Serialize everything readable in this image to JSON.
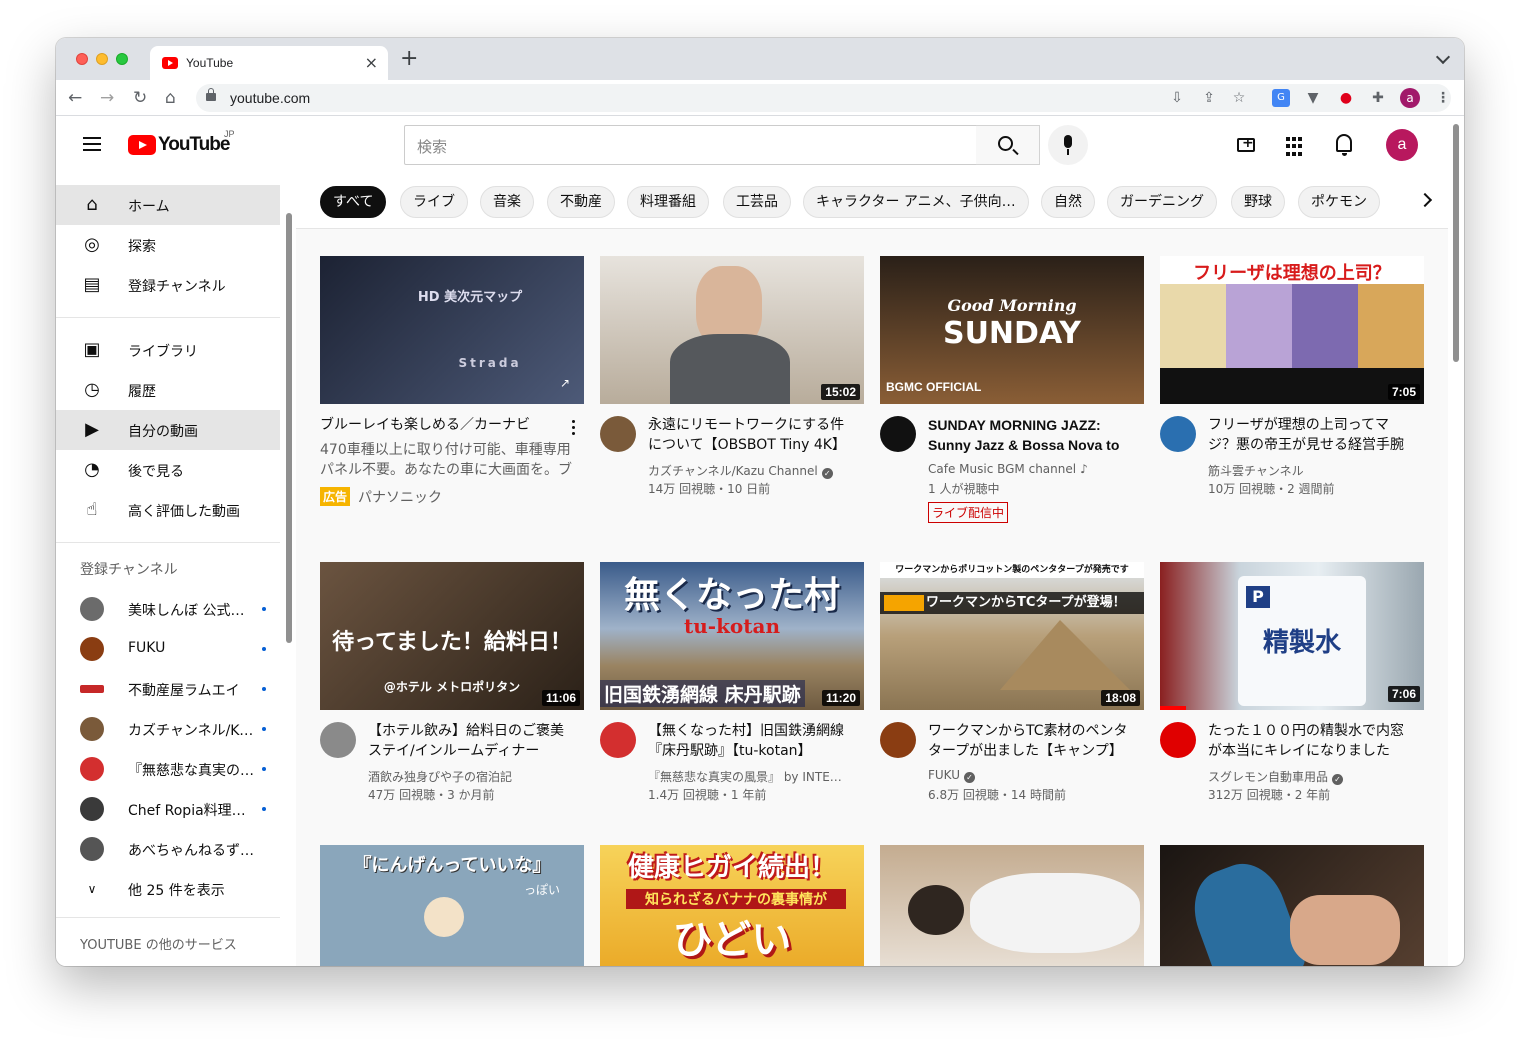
{
  "browser": {
    "tab_title": "YouTube",
    "new_tab": "+",
    "url": "youtube.com",
    "profile_letter": "a"
  },
  "header": {
    "logo_text": "YouTube",
    "country_code": "JP",
    "search_placeholder": "検索",
    "avatar_letter": "a"
  },
  "sidebar": {
    "main": [
      {
        "label": "ホーム",
        "icon": "home-icon",
        "active": true
      },
      {
        "label": "探索",
        "icon": "compass-icon"
      },
      {
        "label": "登録チャンネル",
        "icon": "subscriptions-icon"
      }
    ],
    "library": [
      {
        "label": "ライブラリ",
        "icon": "library-icon"
      },
      {
        "label": "履歴",
        "icon": "history-icon"
      },
      {
        "label": "自分の動画",
        "icon": "my-videos-icon",
        "active": true
      },
      {
        "label": "後で見る",
        "icon": "clock-icon"
      },
      {
        "label": "高く評価した動画",
        "icon": "thumbs-up-icon"
      }
    ],
    "subscriptions_heading": "登録チャンネル",
    "channels": [
      {
        "name": "美味しんぼ 公式チャンネル",
        "color": "#6b6b6b",
        "new": true
      },
      {
        "name": "FUKU",
        "color": "#8a3d12",
        "new": true
      },
      {
        "name": "不動産屋ラムエイ",
        "color": "#c62828",
        "new": true
      },
      {
        "name": "カズチャンネル/Kazu Channel",
        "color": "#7a5a3a",
        "new": true
      },
      {
        "name": "『無慈悲な真実の風景』",
        "color": "#d32f2f",
        "new": true
      },
      {
        "name": "Chef Ropia料理人の話",
        "color": "#3a3a3a",
        "new": true
      },
      {
        "name": "あべちゃんねるず 釣り",
        "color": "#555555",
        "new": false
      }
    ],
    "show_more": "他 25 件を表示",
    "more_services": "YOUTUBE の他のサービス"
  },
  "chips": [
    "すべて",
    "ライブ",
    "音楽",
    "不動産",
    "料理番組",
    "工芸品",
    "キャラクター アニメ、子供向…",
    "自然",
    "ガーデニング",
    "野球",
    "ポケモン"
  ],
  "videos": [
    {
      "title": "ブルーレイも楽しめる／カーナビ",
      "ad": true,
      "description": "470車種以上に取り付け可能、車種専用パネル不要。あなたの車に大画面を。ブルーレイも楽しめる",
      "ad_label": "広告",
      "channel": "パナソニック",
      "thumb_text": "HD 美次元マップ",
      "thumb_sub": "Strada",
      "thumb_bg": "#2b3244"
    },
    {
      "title": "永遠にリモートワークにする件について【OBSBOT Tiny 4K】",
      "channel": "カズチャンネル/Kazu Channel",
      "verified": true,
      "meta": "14万 回視聴・10 日前",
      "duration": "15:02",
      "avatar_color": "#7a5a3a",
      "thumb_bg": "#cfc8bd"
    },
    {
      "title": "SUNDAY MORNING JAZZ: Sunny Jazz & Bossa Nova to Relax",
      "channel": "Cafe Music BGM channel",
      "music": true,
      "meta": "1 人が視聴中",
      "live": "ライブ配信中",
      "thumb_text": "Good Morning",
      "thumb_sub": "SUNDAY",
      "thumb_brand": "BGMC OFFICIAL",
      "avatar_color": "#111111",
      "thumb_bg": "#6b4a2e"
    },
    {
      "title": "フリーザが理想の上司ってマジ？悪の帝王が見せる経営手腕",
      "channel": "筋斗雲チャンネル",
      "meta": "10万 回視聴・2 週間前",
      "duration": "7:05",
      "thumb_text": "フリーザは理想の上司？",
      "avatar_color": "#2a6fb0",
      "thumb_bg": "#f2e7c9"
    },
    {
      "title": "【ホテル飲み】給料日のご褒美ステイ/インルームディナー",
      "channel": "酒飲み独身ぴや子の宿泊記",
      "meta": "47万 回視聴・3 か月前",
      "duration": "11:06",
      "thumb_text": "待ってました！給料日！",
      "thumb_sub": "@ホテル メトロポリタン",
      "avatar_color": "#8a8a8a",
      "thumb_bg": "#4a3a2a"
    },
    {
      "title": "【無くなった村】旧国鉄湧網線『床丹駅跡』【tu-kotan】",
      "channel": "『無慈悲な真実の風景』 by INTERNET",
      "meta": "1.4万 回視聴・1 年前",
      "duration": "11:20",
      "thumb_text": "無くなった村",
      "thumb_sub": "tu-kotan",
      "thumb_bottom": "旧国鉄湧網線 床丹駅跡",
      "avatar_color": "#d32f2f",
      "thumb_bg": "#6e7f96"
    },
    {
      "title": "ワークマンからTC素材のペンタタープが出ました【キャンプ】",
      "channel": "FUKU",
      "verified": true,
      "meta": "6.8万 回視聴・14 時間前",
      "duration": "18:08",
      "thumb_top": "ワークマンからポリコットン製のペンタタープが発売です",
      "thumb_text": "ワークマンからTCタープが登場！",
      "avatar_color": "#8a3d12",
      "thumb_bg": "#b8a07a"
    },
    {
      "title": "たった１００円の精製水で内窓が本当にキレイになりました",
      "channel": "スグレモン自動車用品",
      "verified": true,
      "meta": "312万 回視聴・2 年前",
      "duration": "7:06",
      "thumb_text": "精製水",
      "progress": 0.1,
      "avatar_color": "#e00000",
      "thumb_bg": "#c9d4dc"
    },
    {
      "thumb_text": "『にんげんっていいな』",
      "thumb_sub": "っぽい",
      "thumb_bg": "#8aa6bb"
    },
    {
      "thumb_text": "健康ヒガイ続出！",
      "thumb_sub": "知られざるバナナの裏事情が",
      "thumb_bottom": "ひどい",
      "thumb_bg": "#f2c23a"
    },
    {
      "thumb_bg": "#b49a7c"
    },
    {
      "thumb_bg": "#3a2c24"
    }
  ]
}
